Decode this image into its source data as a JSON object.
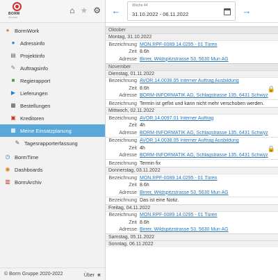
{
  "brand": {
    "logo_text": "BORM",
    "logo_sub": "Informatik"
  },
  "sidebar": {
    "items": [
      {
        "label": "BormWork",
        "icon": "person-icon",
        "level": "top"
      },
      {
        "label": "Adressinfo",
        "icon": "contact-icon",
        "level": "sub"
      },
      {
        "label": "Projektinfo",
        "icon": "document-icon",
        "level": "sub"
      },
      {
        "label": "Auftragsinfo",
        "icon": "wrench-icon",
        "level": "sub"
      },
      {
        "label": "Regierapport",
        "icon": "truck-icon",
        "level": "sub"
      },
      {
        "label": "Lieferungen",
        "icon": "delivery-icon",
        "level": "sub"
      },
      {
        "label": "Bestellungen",
        "icon": "cart-icon",
        "level": "sub"
      },
      {
        "label": "Kreditoren",
        "icon": "list-icon",
        "level": "sub"
      },
      {
        "label": "Meine Einsatzplanung",
        "icon": "calendar-icon",
        "level": "sub",
        "active": true
      },
      {
        "label": "Tagesrapporterfassung",
        "icon": "edit-icon",
        "level": "sub2"
      },
      {
        "label": "BormTime",
        "icon": "clock-icon",
        "level": "top"
      },
      {
        "label": "Dashboards",
        "icon": "dashboard-icon",
        "level": "top"
      },
      {
        "label": "BormArchiv",
        "icon": "archive-icon",
        "level": "top"
      }
    ]
  },
  "footer": {
    "copyright": "© Borm Gruppe 2020-2022",
    "about": "Über",
    "collapse": "«"
  },
  "topbar": {
    "week_label": "Woche 44",
    "week_range": "31.10.2022 - 06.11.2022"
  },
  "labels": {
    "bezeichnung": "Bezeichnung",
    "zeit": "Zeit",
    "adresse": "Adresse"
  },
  "schedule": {
    "oktober": "Oktober",
    "november": "November",
    "day1": {
      "date": "Montag, 31.10.2022",
      "e1": {
        "bez": "MON.RPF-0089.14.0295 - 01 Türen",
        "zeit": "8.6h",
        "adr": "Birrer, Wildspitzstrasse 53, 5630 Muri AG"
      }
    },
    "day2": {
      "date": "Dienstag, 01.11.2022",
      "e1": {
        "bez": "AVOR.14.0038.05 Interner Auftrag Ausbildung",
        "zeit": "8.6h",
        "adr": "BORM-INFORMATIK AG, Schlagstrasse 135, 6431 Schwyz"
      },
      "note": "Termin ist gefixt und kann nicht mehr verschoben werden."
    },
    "day3": {
      "date": "Mittwoch, 02.11.2022",
      "e1": {
        "bez": "AVOR.14.0097.01 Interner Auftrag",
        "zeit": "4h",
        "adr": "BORM-INFORMATIK AG, Schlagstrasse 135, 6431 Schwyz"
      },
      "e2": {
        "bez": "AVOR.14.0038.05 Interner Auftrag Ausbildung",
        "zeit": "4h",
        "adr": "BORM-INFORMATIK AG, Schlagstrasse 135, 6431 Schwyz"
      },
      "note": "Termin fix"
    },
    "day4": {
      "date": "Donnerstag, 03.11.2022",
      "e1": {
        "bez": "MON.RPF-0089.14.0295 - 01 Türen",
        "zeit": "8.6h",
        "adr": "Birrer, Wildspitzstrasse 53, 5630 Muri AG"
      },
      "note": "Das ist eine Notiz."
    },
    "day5": {
      "date": "Freitag, 04.11.2022",
      "e1": {
        "bez": "MON.RPF-0089.14.0295 - 01 Türen",
        "zeit": "8.6h",
        "adr": "Birrer, Wildspitzstrasse 53, 5630 Muri AG"
      }
    },
    "day6": {
      "date": "Samstag, 05.11.2022"
    },
    "day7": {
      "date": "Sonntag, 06.11.2022"
    }
  },
  "colors": {
    "accent": "#5aa7d9",
    "link": "#2a74b8",
    "arrow": "#2c7fc4",
    "lock": "#d8a000"
  }
}
